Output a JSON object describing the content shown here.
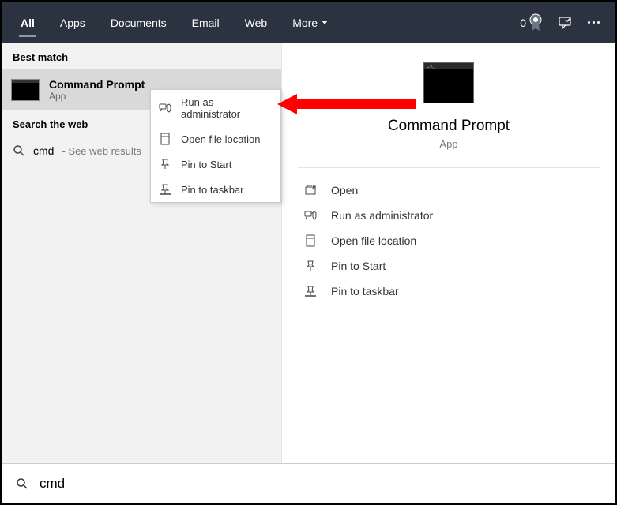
{
  "topbar": {
    "tabs": [
      "All",
      "Apps",
      "Documents",
      "Email",
      "Web",
      "More"
    ],
    "badge_count": "0"
  },
  "left": {
    "best_match_header": "Best match",
    "result_title": "Command Prompt",
    "result_sub": "App",
    "search_web_header": "Search the web",
    "web_query": "cmd",
    "web_suffix": " - See web results"
  },
  "context_menu": {
    "items": [
      "Run as administrator",
      "Open file location",
      "Pin to Start",
      "Pin to taskbar"
    ]
  },
  "right": {
    "hero_title": "Command Prompt",
    "hero_sub": "App",
    "actions": [
      "Open",
      "Run as administrator",
      "Open file location",
      "Pin to Start",
      "Pin to taskbar"
    ]
  },
  "searchbar": {
    "value": "cmd"
  }
}
